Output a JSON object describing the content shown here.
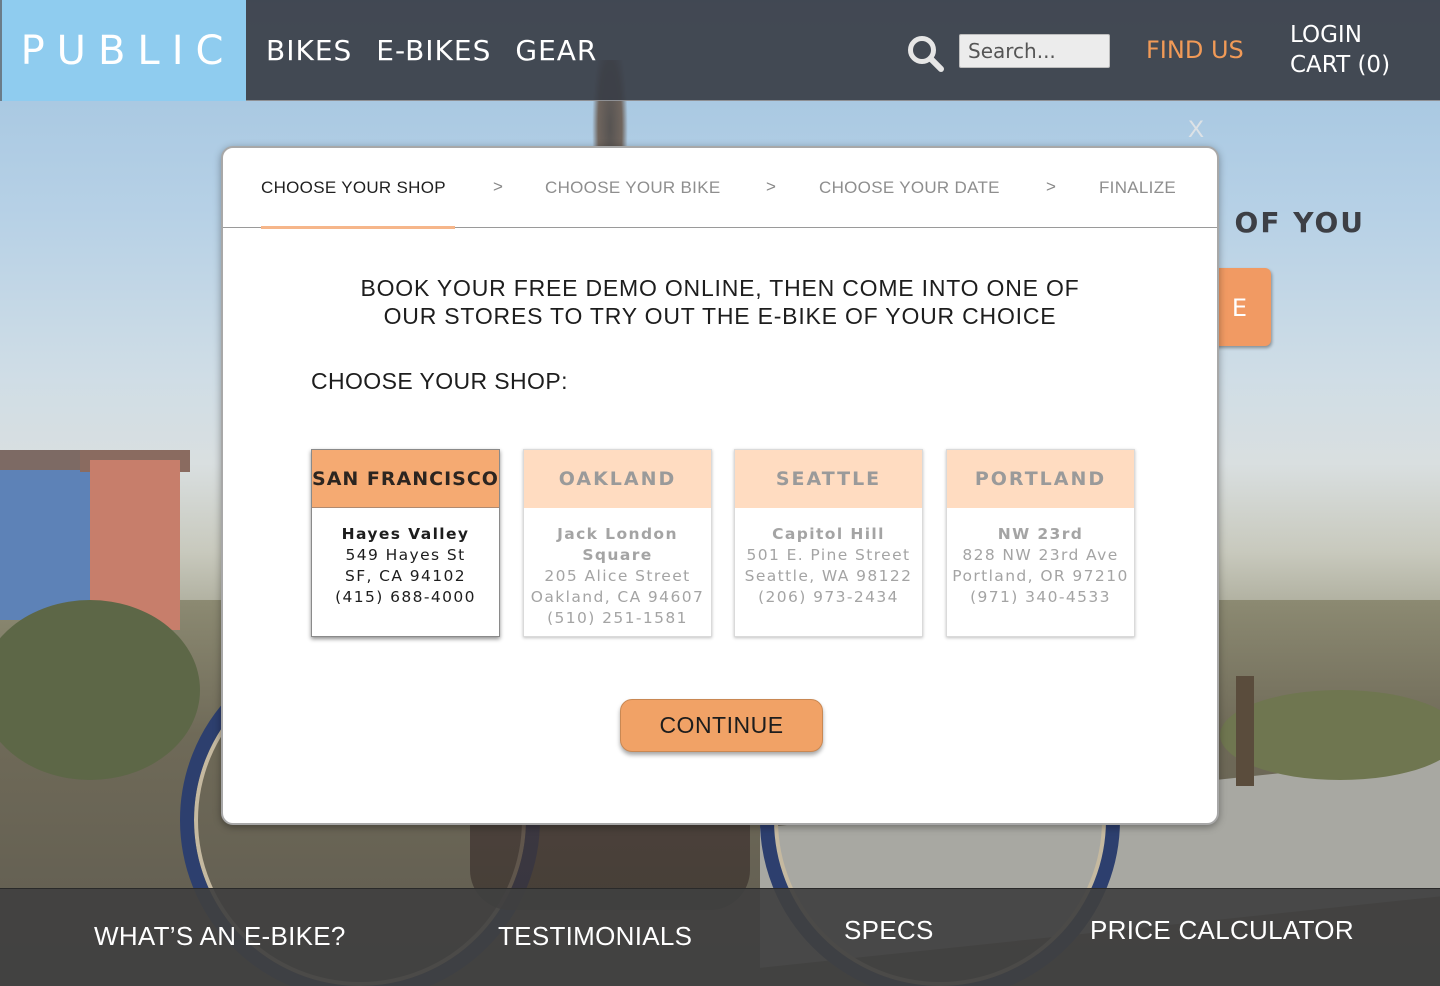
{
  "header": {
    "logo": "PUBLIC",
    "nav": [
      "BIKES",
      "E-BIKES",
      "GEAR"
    ],
    "search_placeholder": "Search...",
    "find_us": "FIND US",
    "login": "LOGIN",
    "cart": "CART (0)"
  },
  "hero": {
    "tagline_fragment": ") OF YOU",
    "button_fragment": "E"
  },
  "modal": {
    "close_label": "X",
    "steps": [
      {
        "label": "CHOOSE YOUR SHOP",
        "active": true
      },
      {
        "label": "CHOOSE YOUR BIKE",
        "active": false
      },
      {
        "label": "CHOOSE YOUR DATE",
        "active": false
      },
      {
        "label": "FINALIZE",
        "active": false
      }
    ],
    "step_separator": ">",
    "headline_line1": "BOOK YOUR FREE DEMO ONLINE, THEN COME INTO ONE OF",
    "headline_line2": "OUR STORES TO TRY OUT THE E-BIKE OF YOUR CHOICE",
    "choose_label": "CHOOSE YOUR SHOP:",
    "shops": [
      {
        "city": "SAN FRANCISCO",
        "neighborhood": "Hayes Valley",
        "street": "549 Hayes St",
        "citystate": "SF, CA 94102",
        "phone": "(415) 688-4000",
        "selected": true
      },
      {
        "city": "OAKLAND",
        "neighborhood": "Jack London Square",
        "street": "205 Alice Street",
        "citystate": "Oakland, CA 94607",
        "phone": "(510) 251-1581",
        "selected": false
      },
      {
        "city": "SEATTLE",
        "neighborhood": "Capitol Hill",
        "street": "501 E. Pine Street",
        "citystate": "Seattle, WA 98122",
        "phone": "(206) 973-2434",
        "selected": false
      },
      {
        "city": "PORTLAND",
        "neighborhood": "NW 23rd",
        "street": "828 NW 23rd Ave",
        "citystate": "Portland, OR 97210",
        "phone": "(971) 340-4533",
        "selected": false
      }
    ],
    "continue_label": "CONTINUE"
  },
  "footer": {
    "links": [
      "WHAT’S AN E-BIKE?",
      "TESTIMONIALS",
      "SPECS",
      "PRICE CALCULATOR"
    ]
  },
  "colors": {
    "accent": "#f19a57",
    "logo_bg": "#8fccef",
    "selected_tab": "#f5aa72",
    "unselected_tab": "#ffdcc1",
    "header_bg": "#3a3e46"
  },
  "icons": {
    "search": "search-icon",
    "close": "close-icon"
  }
}
